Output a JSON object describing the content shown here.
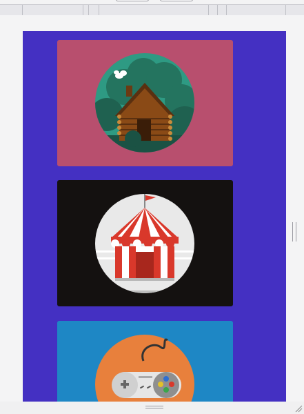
{
  "toolbar": {
    "button_a_label": "",
    "button_b_label": ""
  },
  "cards": [
    {
      "name": "log-cabin-card",
      "bg": "#b84f6e",
      "icon": "log-cabin-icon"
    },
    {
      "name": "circus-tent-card",
      "bg": "#141110",
      "icon": "circus-tent-icon"
    },
    {
      "name": "game-controller-card",
      "bg": "#1e87c5",
      "icon": "game-controller-icon"
    }
  ],
  "colors": {
    "content_bg": "#4430c2",
    "page_bg": "#f4f4f5"
  }
}
